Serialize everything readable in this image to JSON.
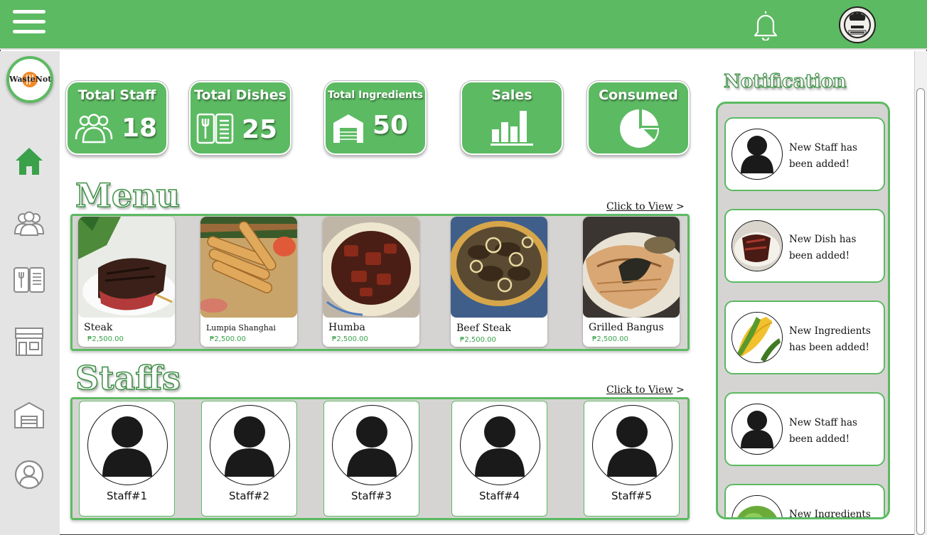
{
  "topbar": {
    "menu_icon": "hamburger-icon",
    "bell_icon": "bell-icon",
    "avatar_icon": "restaurant-chef-logo"
  },
  "brand": {
    "logo_text": "WasteNot",
    "accent": "#5cba62"
  },
  "sidebar": {
    "items": [
      {
        "icon": "home-icon",
        "active": true
      },
      {
        "icon": "staff-icon",
        "active": false
      },
      {
        "icon": "menu-book-icon",
        "active": false
      },
      {
        "icon": "store-icon",
        "active": false
      },
      {
        "icon": "warehouse-icon",
        "active": false
      },
      {
        "icon": "profile-icon",
        "active": false
      }
    ]
  },
  "stats": [
    {
      "title": "Total Staff",
      "value": "18",
      "icon": "staff-icon"
    },
    {
      "title": "Total Dishes",
      "value": "25",
      "icon": "menu-book-icon"
    },
    {
      "title": "Total Ingredients",
      "value": "50",
      "icon": "warehouse-icon"
    },
    {
      "title": "Sales",
      "value": "",
      "icon": "bar-chart-icon"
    },
    {
      "title": "Consumed",
      "value": "",
      "icon": "pie-chart-icon"
    }
  ],
  "menu": {
    "title": "Menu",
    "view_link": "Click to View",
    "view_arrow": ">",
    "dishes": [
      {
        "name": "Steak",
        "price": "₱2,500.00"
      },
      {
        "name": "Lumpia Shanghai",
        "price": "₱2,500.00"
      },
      {
        "name": "Humba",
        "price": "₱2,500.00"
      },
      {
        "name": "Beef Steak",
        "price": "₱2,500.00"
      },
      {
        "name": "Grilled Bangus",
        "price": "₱2,500.00"
      }
    ]
  },
  "staffs": {
    "title": "Staffs",
    "view_link": "Click to View",
    "view_arrow": ">",
    "members": [
      {
        "label": "Staff#1"
      },
      {
        "label": "Staff#2"
      },
      {
        "label": "Staff#3"
      },
      {
        "label": "Staff#4"
      },
      {
        "label": "Staff#5"
      }
    ]
  },
  "notifications": {
    "title": "Notification",
    "items": [
      {
        "line1": "New Staff has",
        "line2": "been added!",
        "icon": "person-icon"
      },
      {
        "line1": "New Dish has",
        "line2": "been added!",
        "icon": "dish-photo"
      },
      {
        "line1": "New Ingredients",
        "line2": "has been added!",
        "icon": "corn-photo"
      },
      {
        "line1": "New Staff has",
        "line2": "been added!",
        "icon": "person-icon"
      },
      {
        "line1": "New Ingredients",
        "line2": "",
        "icon": "lettuce-photo"
      }
    ]
  }
}
